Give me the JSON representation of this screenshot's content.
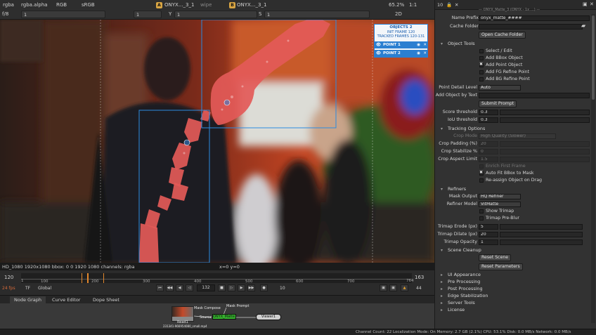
{
  "viewer_toolbar": {
    "channel_set": "rgba",
    "layer": "rgba.alpha",
    "display_channels": "RGB",
    "colorspace": "sRGB",
    "input_a": "ONYX..._3_1",
    "wipe": "wipe",
    "input_b": "ONYX..._3_1",
    "zoom": "65.2%",
    "ratio": "1:1",
    "view_mode": "2D",
    "fstop": "f/8",
    "frame_field": "1",
    "gain_field": "1",
    "y_label": "Y",
    "y_value": "1",
    "s_label": "S",
    "s_value": "1"
  },
  "overlay": {
    "title": "OBJECTS 2",
    "init_frame": "INIT FRAME 120",
    "tracked": "TRACKED FRAMES 120-131",
    "points": [
      "POINT 1",
      "POINT 2"
    ],
    "accent": "#2b7fd1"
  },
  "viewer_status": {
    "info": "HD_1080 1920x1080  bbox: 0 0 1920 1080 channels: rgba",
    "coords": "x=0 y=0"
  },
  "timeline": {
    "in_frame": "120",
    "out_frame": "163",
    "ticks": [
      "1",
      "100",
      "200",
      "300",
      "400",
      "500",
      "600",
      "700"
    ],
    "tick_start": "1",
    "tick_end": "764",
    "fps": "24 fps",
    "tf": "TF",
    "global": "Global",
    "current_frame": "132",
    "step": "10",
    "end_field": "44"
  },
  "node_graph": {
    "tabs": [
      "Node Graph",
      "Curve Editor",
      "Dope Sheet"
    ],
    "nodes": {
      "read": "Read1",
      "read_file": "231341-966954080_small.mp4",
      "mask_comp": "Mask Compose",
      "mask_prompt": "Mask Prompt",
      "onyx": "ONYX_Matte_3",
      "viewer": "Viewer1",
      "source": "Source"
    }
  },
  "properties": {
    "header": "10",
    "top_cut": "— ONYX_Matte_3 (ONYX - 1x …) —",
    "name_prefix_label": "Name Prefix",
    "name_prefix": "onyx_matte_####",
    "cache_folder_label": "Cache Folder",
    "open_cache": "Open Cache Folder",
    "object_tools": "Object Tools",
    "select_edit": "Select / Edit",
    "add_bbox": "Add BBox Object",
    "add_point": "Add Point Object",
    "add_fg": "Add FG Refine Point",
    "add_bg": "Add BG Refine Point",
    "detail_label": "Point Detail Level",
    "detail_value": "Auto",
    "add_text_label": "Add Object by Text",
    "submit_prompt": "Submit Prompt",
    "score_label": "Score threshold",
    "score_value": "0.3",
    "iou_label": "IoU threshold",
    "iou_value": "0.3",
    "tracking_options": "Tracking Options",
    "crop_mode_label": "Crop Mode",
    "crop_mode_value": "High Quality (Slower)",
    "crop_padding_label": "Crop Padding (%)",
    "crop_padding_value": "20",
    "crop_stabilize_label": "Crop Stabilize %",
    "crop_stabilize_value": "0",
    "crop_aspect_label": "Crop Aspect Limit",
    "crop_aspect_value": "1.5",
    "enrich_first": "Enrich First Frame",
    "auto_fit": "Auto Fit BBox to Mask",
    "reassign": "Re-assign Object on Drag",
    "refiners": "Refiners",
    "mask_output_label": "Mask Output",
    "mask_output_value": "HQ Refiner",
    "refiner_model_label": "Refiner Model",
    "refiner_model_value": "VitMatte",
    "show_trimap": "Show Trimap",
    "trimap_preblur": "Trimap Pre-Blur",
    "trimap_erode_label": "Trimap Erode (px)",
    "trimap_erode_value": "5",
    "trimap_dilate_label": "Trimap Dilate (px)",
    "trimap_dilate_value": "20",
    "trimap_opacity_label": "Trimap Opacity",
    "trimap_opacity_value": "1",
    "scene_cleanup": "Scene Cleanup",
    "reset_scene": "Reset Scene",
    "reset_params": "Reset Parameters",
    "sections": [
      "UI Appearance",
      "Pre Processing",
      "Post Processing",
      "Edge Stabilization",
      "Server Tools",
      "License"
    ]
  },
  "status_bar": "Channel Count: 22  Localization Mode: On  Memory: 2.7 GB (2.1%)  CPU: 53.1%  Disk: 0.0 MB/s  Network: 0.0 MB/s"
}
